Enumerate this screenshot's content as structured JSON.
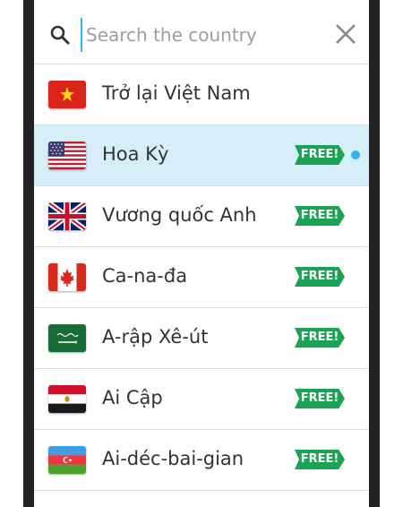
{
  "search": {
    "placeholder": "Search the country",
    "value": ""
  },
  "accent_color": "#29b6f6",
  "badge_color": "#1aa355",
  "countries": [
    {
      "name": "Trở lại Việt Nam",
      "flag": "vietnam-flag-icon",
      "badge": "",
      "selected": false
    },
    {
      "name": "Hoa Kỳ",
      "flag": "usa-flag-icon",
      "badge": "FREE!",
      "selected": true
    },
    {
      "name": "Vương quốc Anh",
      "flag": "uk-flag-icon",
      "badge": "FREE!",
      "selected": false
    },
    {
      "name": "Ca-na-đa",
      "flag": "canada-flag-icon",
      "badge": "FREE!",
      "selected": false
    },
    {
      "name": "A-rập Xê-út",
      "flag": "saudi-arabia-flag-icon",
      "badge": "FREE!",
      "selected": false
    },
    {
      "name": "Ai Cập",
      "flag": "egypt-flag-icon",
      "badge": "FREE!",
      "selected": false
    },
    {
      "name": "Ai-déc-bai-gian",
      "flag": "azerbaijan-flag-icon",
      "badge": "FREE!",
      "selected": false
    }
  ]
}
